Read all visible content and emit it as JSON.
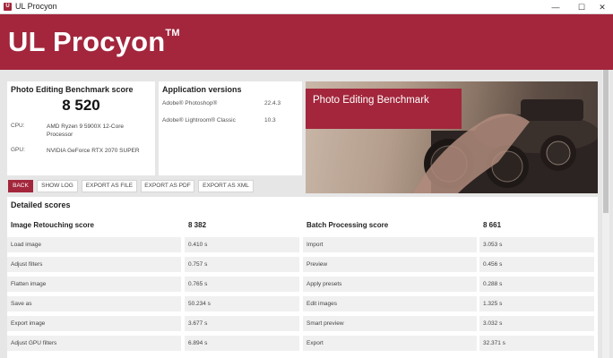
{
  "window": {
    "title": "UL Procyon",
    "minimize": "—",
    "maximize": "☐",
    "close": "✕"
  },
  "banner": {
    "brand": "UL Procyon",
    "tm": "TM"
  },
  "score_panel": {
    "title": "Photo Editing Benchmark score",
    "score": "8 520",
    "cpu_label": "CPU:",
    "cpu_value": "AMD Ryzen 9 5900X 12-Core Processor",
    "gpu_label": "GPU:",
    "gpu_value": "NVIDIA GeForce RTX 2070 SUPER"
  },
  "app_panel": {
    "title": "Application versions",
    "apps": [
      {
        "name": "Adobe® Photoshop®",
        "version": "22.4.3"
      },
      {
        "name": "Adobe® Lightroom® Classic",
        "version": "10.3"
      }
    ]
  },
  "hero": {
    "label": "Photo Editing Benchmark"
  },
  "buttons": {
    "back": "BACK",
    "show_log": "SHOW LOG",
    "export_file": "EXPORT AS FILE",
    "export_pdf": "EXPORT AS PDF",
    "export_xml": "EXPORT AS XML"
  },
  "details": {
    "title": "Detailed scores",
    "left": {
      "header": {
        "label": "Image Retouching score",
        "value": "8 382"
      },
      "rows": [
        {
          "label": "Load image",
          "value": "0.410 s"
        },
        {
          "label": "Adjust filters",
          "value": "0.757 s"
        },
        {
          "label": "Flatten image",
          "value": "0.765 s"
        },
        {
          "label": "Save as",
          "value": "50.234 s"
        },
        {
          "label": "Export image",
          "value": "3.677 s"
        },
        {
          "label": "Adjust GPU filters",
          "value": "6.894 s"
        }
      ]
    },
    "right": {
      "header": {
        "label": "Batch Processing score",
        "value": "8 661"
      },
      "rows": [
        {
          "label": "Import",
          "value": "3.053 s"
        },
        {
          "label": "Preview",
          "value": "0.456 s"
        },
        {
          "label": "Apply presets",
          "value": "0.288 s"
        },
        {
          "label": "Edit images",
          "value": "1.325 s"
        },
        {
          "label": "Smart preview",
          "value": "3.032 s"
        },
        {
          "label": "Export",
          "value": "32.371 s"
        }
      ]
    }
  },
  "colors": {
    "accent": "#a3263c",
    "background": "#e6e6e6",
    "panel": "#ffffff",
    "row": "#f0f0f0"
  }
}
